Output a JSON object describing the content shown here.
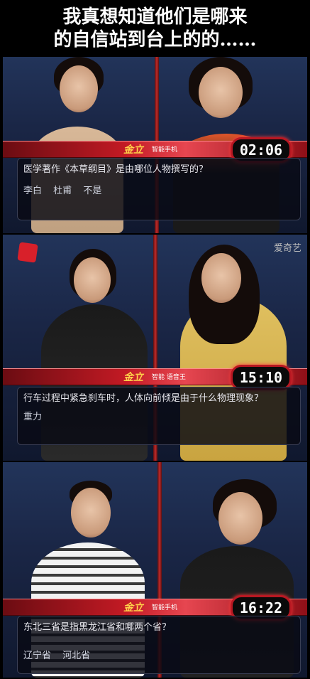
{
  "caption": {
    "line1": "我真想知道他们是哪来",
    "line2": "的自信站到台上的的……"
  },
  "panels": [
    {
      "brand": "金立",
      "brand_sub": "智能手机",
      "timer": "02:06",
      "question": "医学著作《本草纲目》是由哪位人物撰写的？",
      "answers": [
        "李白",
        "杜甫",
        "不是"
      ]
    },
    {
      "brand": "金立",
      "brand_sub": "智能 语音王",
      "timer": "15:10",
      "watermark": "爱奇艺",
      "question": "行车过程中紧急刹车时，人体向前倾是由于什么物理现象？",
      "answers": [
        "重力"
      ]
    },
    {
      "brand": "金立",
      "brand_sub": "智能手机",
      "timer": "16:22",
      "question": "东北三省是指黑龙江省和哪两个省？",
      "answers": [
        "辽宁省",
        "河北省"
      ]
    }
  ],
  "colors": {
    "accent_red": "#c21a24",
    "timer_glow": "#ff3b3b",
    "brand_yellow": "#ffd24a"
  }
}
